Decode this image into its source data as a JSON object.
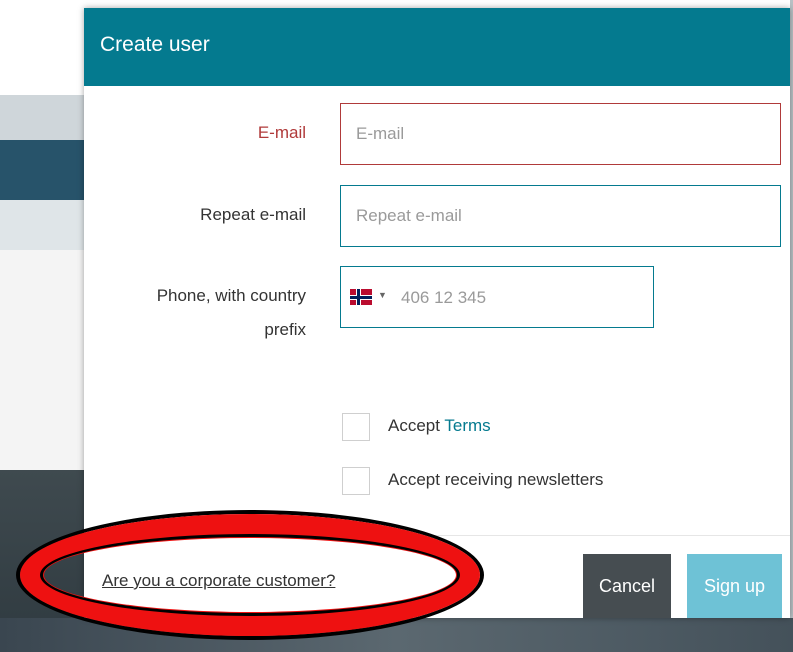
{
  "dialog": {
    "title": "Create user"
  },
  "form": {
    "email": {
      "label": "E-mail",
      "placeholder": "E-mail",
      "value": ""
    },
    "repeat_email": {
      "label": "Repeat e-mail",
      "placeholder": "Repeat e-mail",
      "value": ""
    },
    "phone": {
      "label_line1": "Phone, with country",
      "label_line2": "prefix",
      "country_flag": "norway-flag-icon",
      "placeholder": "406 12 345",
      "value": ""
    },
    "accept_terms": {
      "prefix": "Accept ",
      "link_text": "Terms",
      "checked": false
    },
    "newsletters": {
      "label": "Accept receiving newsletters",
      "checked": false
    }
  },
  "footer": {
    "corporate_link": "Are you a corporate customer?",
    "cancel_label": "Cancel",
    "signup_label": "Sign up"
  },
  "colors": {
    "header": "#047a8f",
    "error": "#b03a3a",
    "cancel_button": "#464d51",
    "signup_button": "#6ec2d6",
    "annotation": "#ee1111"
  }
}
